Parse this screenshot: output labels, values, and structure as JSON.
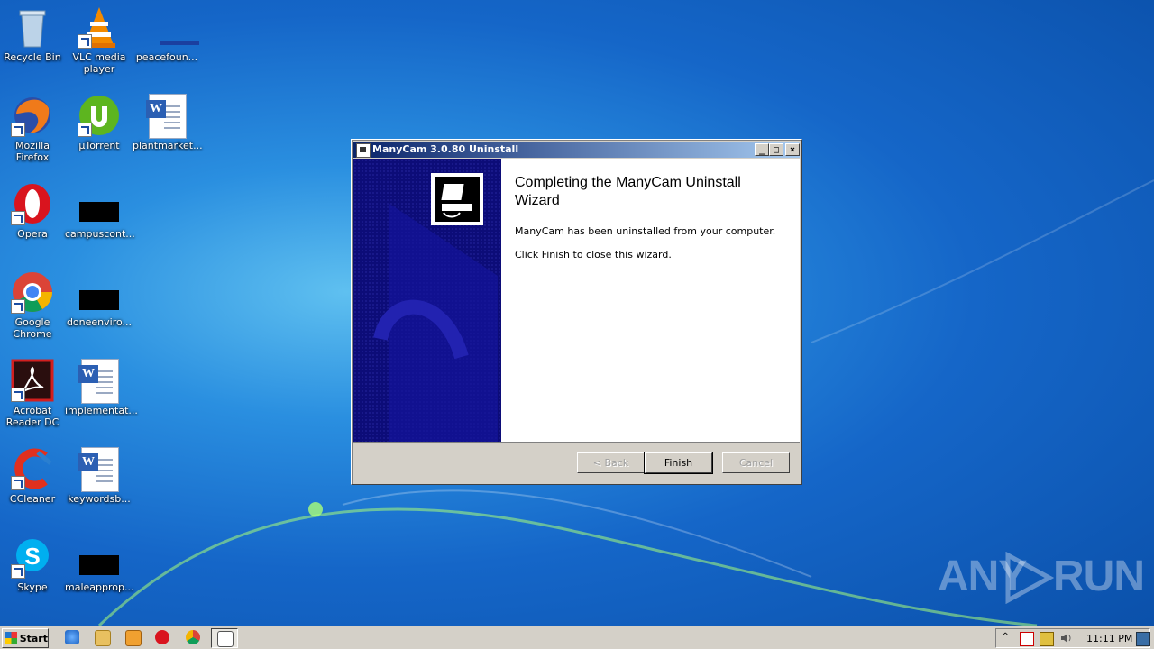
{
  "desktop": {
    "icons": [
      {
        "label": "Recycle Bin"
      },
      {
        "label": "VLC media player"
      },
      {
        "label": "peacefoun..."
      },
      {
        "label": "Mozilla Firefox"
      },
      {
        "label": "µTorrent"
      },
      {
        "label": "plantmarket..."
      },
      {
        "label": "Opera"
      },
      {
        "label": "campuscont..."
      },
      {
        "label": "Google Chrome"
      },
      {
        "label": "doneenviro..."
      },
      {
        "label": "Acrobat Reader DC"
      },
      {
        "label": "implementat..."
      },
      {
        "label": "CCleaner"
      },
      {
        "label": "keywordsb..."
      },
      {
        "label": "Skype"
      },
      {
        "label": "maleapprop..."
      }
    ]
  },
  "window": {
    "title": "ManyCam 3.0.80 Uninstall",
    "heading": "Completing the ManyCam Uninstall Wizard",
    "message1": "ManyCam has been uninstalled from your computer.",
    "message2": "Click Finish to close this wizard.",
    "buttons": {
      "back": "< Back",
      "finish": "Finish",
      "cancel": "Cancel"
    }
  },
  "watermark": {
    "left": "ANY",
    "right": "RUN"
  },
  "taskbar": {
    "start_label": "Start",
    "clock": "11:11 PM"
  }
}
